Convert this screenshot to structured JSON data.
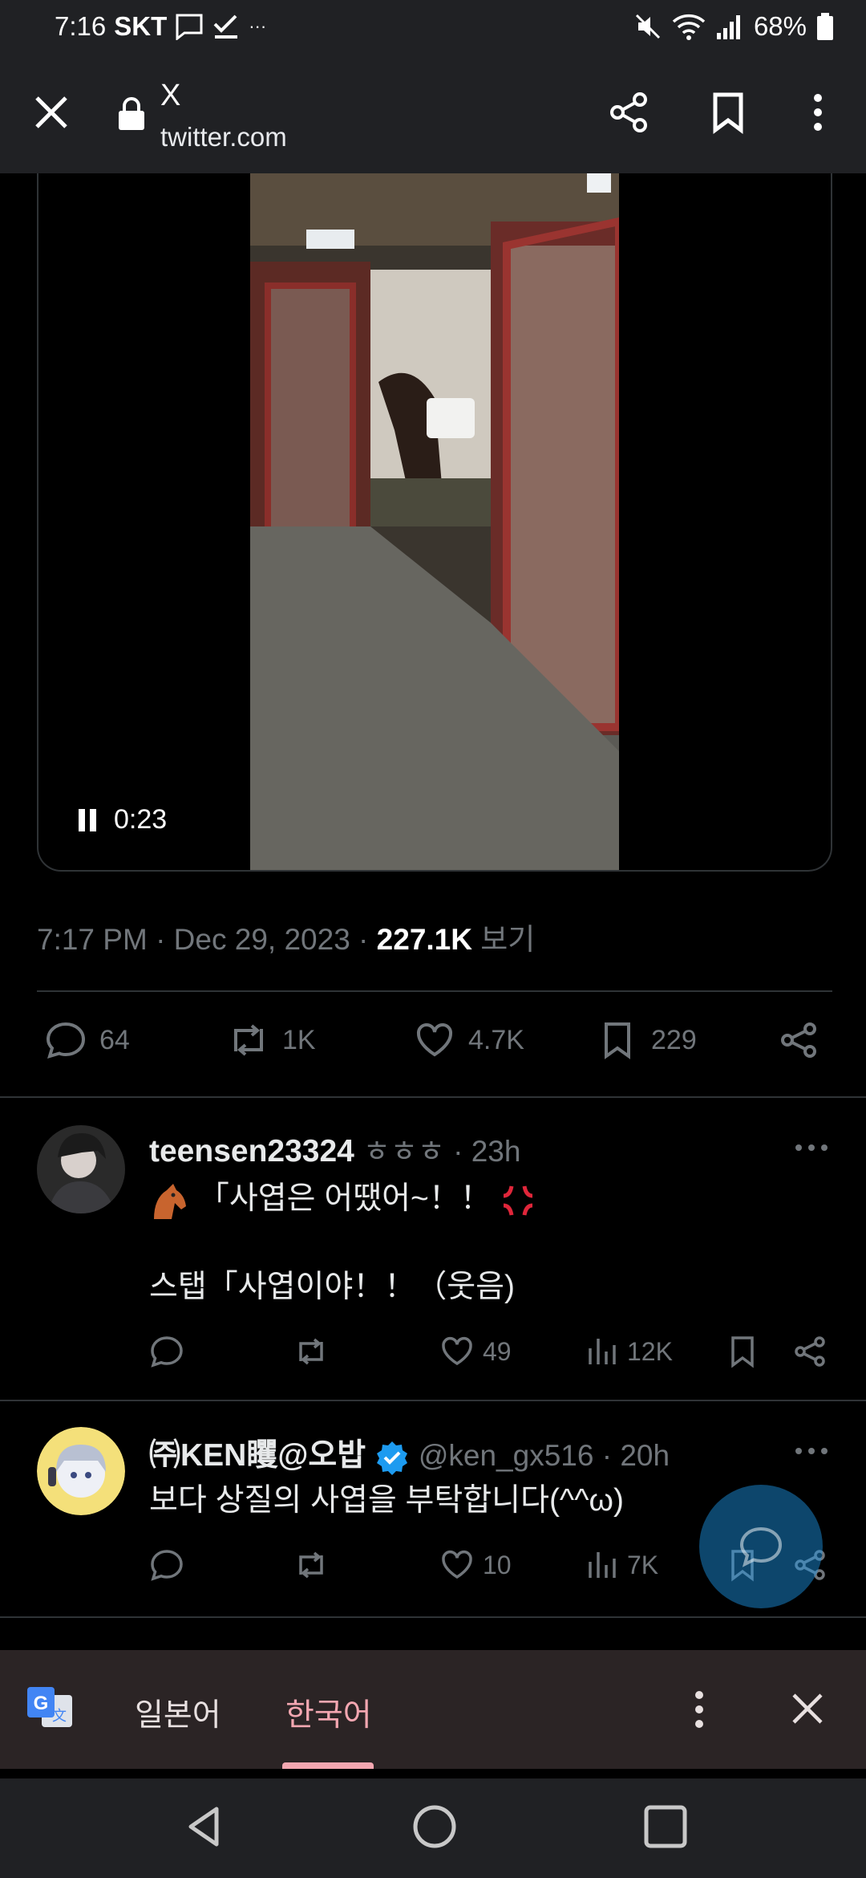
{
  "status_bar": {
    "time": "7:16",
    "carrier": "SKT",
    "dots": "···",
    "battery": "68%"
  },
  "browser": {
    "page_title": "X",
    "url": "twitter.com",
    "icons": [
      "close-icon",
      "lock-icon",
      "share-icon",
      "bookmark-icon",
      "more-vert-icon"
    ]
  },
  "video": {
    "time_remaining": "0:23",
    "state": "playing"
  },
  "tweet": {
    "timestamp": "7:17 PM · Dec 29, 2023 · ",
    "views_count": "227.1K",
    "views_label": "보기",
    "replies": "64",
    "reposts": "1K",
    "likes": "4.7K",
    "bookmarks": "229"
  },
  "replies": [
    {
      "name": "teensen23324",
      "handle": "ㅎㅎㅎ · 23h",
      "line1": "「사엽은 어땠어~！！",
      "line2": "스탭「사엽이야！！（웃음)",
      "replies": "",
      "reposts": "",
      "likes": "49",
      "views": "12K"
    },
    {
      "name": "㈜KEN䂄@오밥",
      "handle": "@ken_gx516 · 20h",
      "line1": "보다 상질의 사엽을 부탁합니다(^^ω)",
      "replies": "",
      "reposts": "",
      "likes": "10",
      "views": "7K"
    }
  ],
  "translate_bar": {
    "source_lang": "일본어",
    "target_lang": "한국어",
    "accent_color": "#f4a7b1"
  },
  "colors": {
    "background": "#000000",
    "muted_text": "#71767b",
    "primary_text": "#e7e9ea",
    "verified_blue": "#1d9bf0"
  }
}
